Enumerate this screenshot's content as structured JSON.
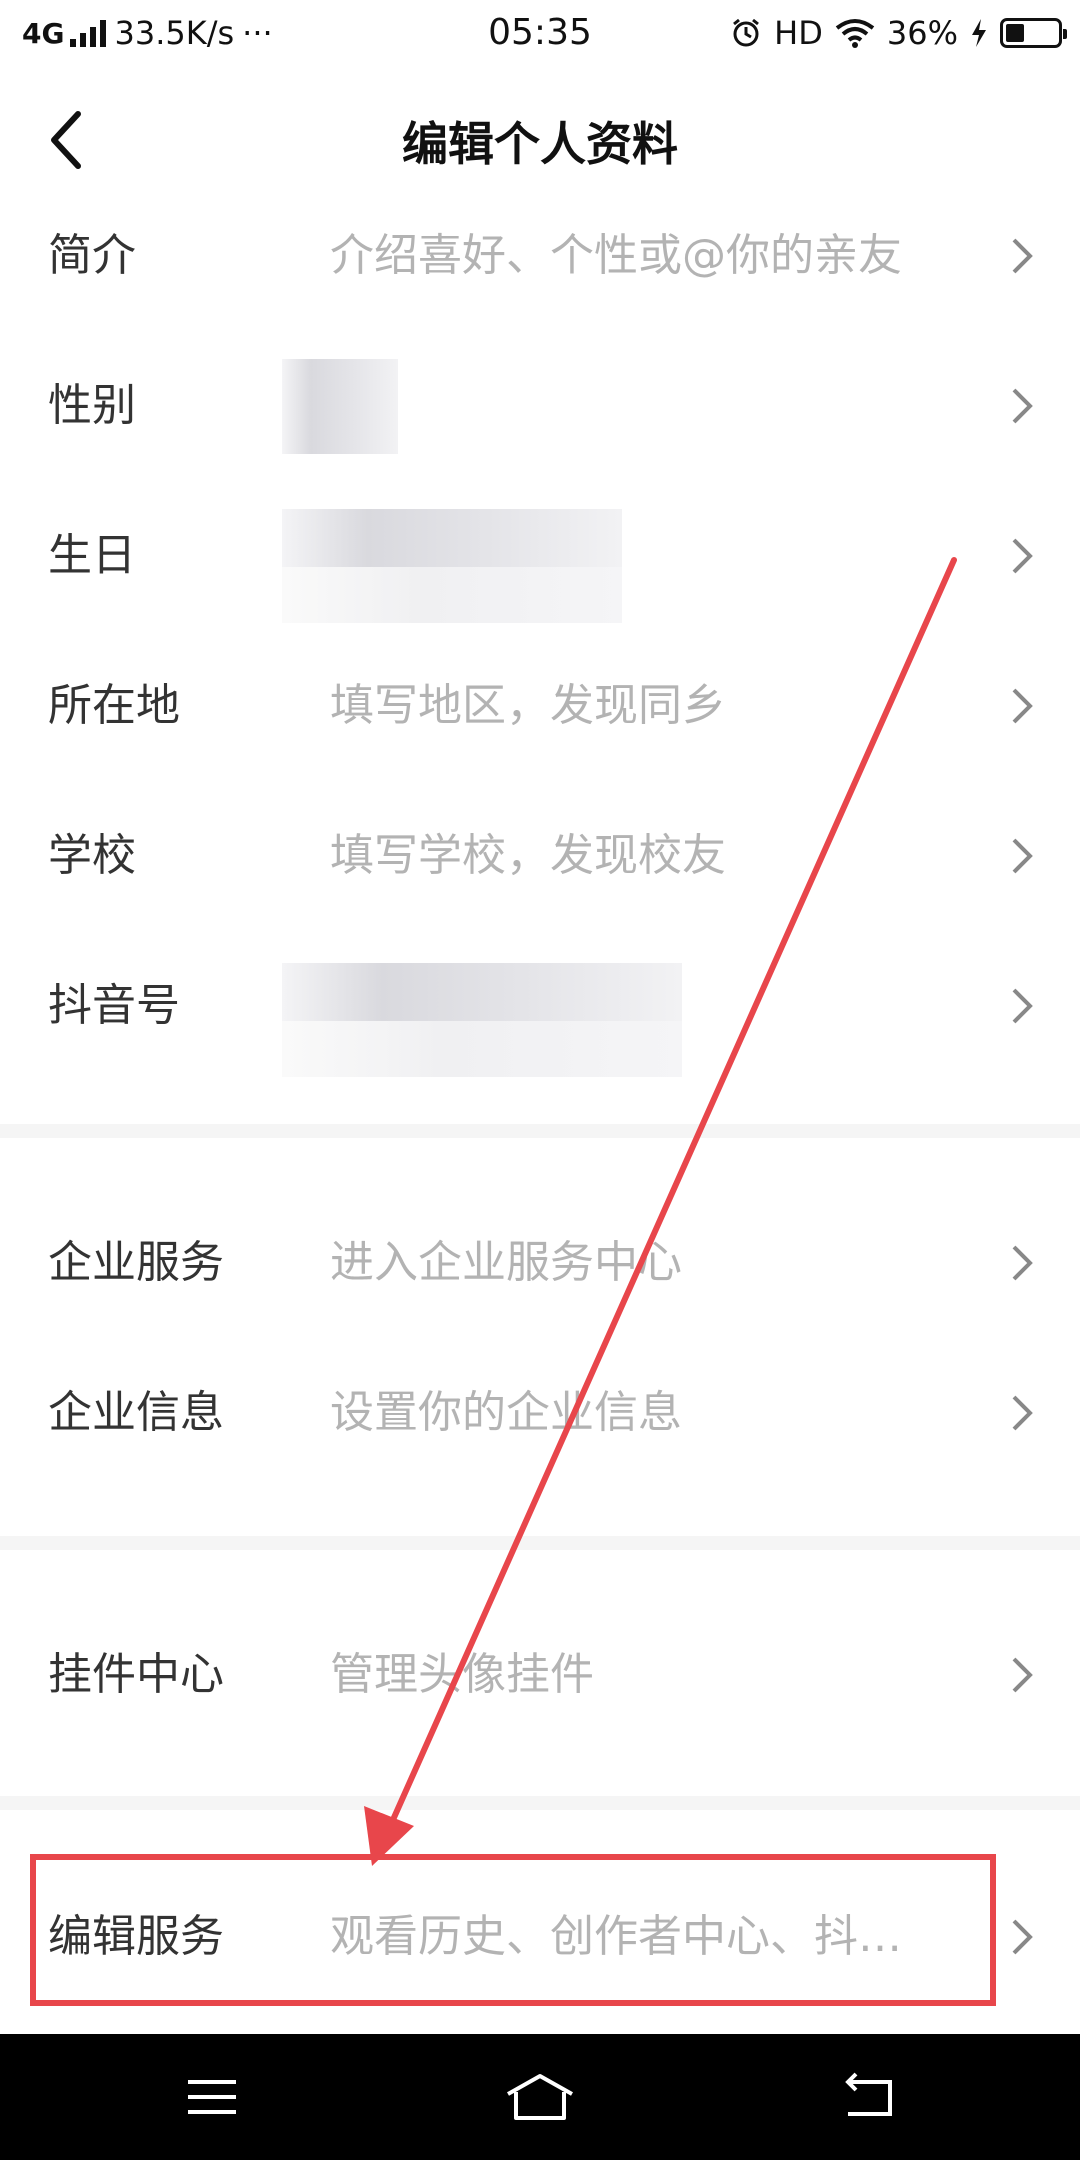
{
  "status_bar": {
    "network": "4G",
    "speed": "33.5K/s",
    "more": "···",
    "time": "05:35",
    "hd": "HD",
    "battery_text": "36%",
    "battery_level": 0.36
  },
  "header": {
    "title": "编辑个人资料"
  },
  "rows": [
    {
      "label": "简介",
      "value": "介绍喜好、个性或@你的亲友"
    },
    {
      "label": "性别",
      "value": ""
    },
    {
      "label": "生日",
      "value": ""
    },
    {
      "label": "所在地",
      "value": "填写地区，发现同乡"
    },
    {
      "label": "学校",
      "value": "填写学校，发现校友"
    },
    {
      "label": "抖音号",
      "value": ""
    },
    {
      "label": "企业服务",
      "value": "进入企业服务中心"
    },
    {
      "label": "企业信息",
      "value": "设置你的企业信息"
    },
    {
      "label": "挂件中心",
      "value": "管理头像挂件"
    },
    {
      "label": "编辑服务",
      "value": "观看历史、创作者中心、抖…"
    }
  ],
  "colors": {
    "annotation": "#e8464b",
    "value_text": "#b3b3b3",
    "divider": "#f5f5f5"
  },
  "icons": {
    "back": "chevron-left-icon",
    "row_arrow": "chevron-right-icon",
    "nav_menu": "menu-icon",
    "nav_home": "home-icon",
    "nav_back": "back-icon"
  }
}
